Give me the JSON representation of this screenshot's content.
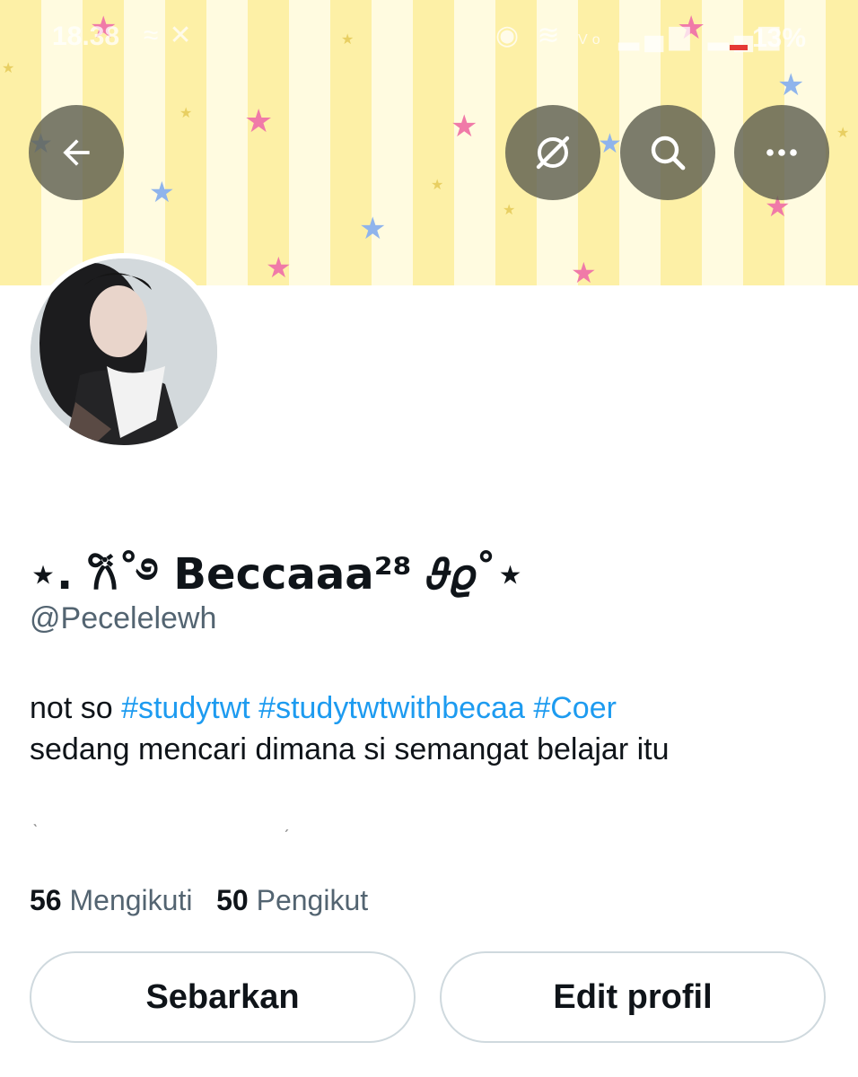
{
  "status_bar": {
    "time": "18.38",
    "battery": "13%",
    "icons_left": [
      "vpn-icon",
      "x-app-icon"
    ],
    "icons_right": [
      "location-icon",
      "wifi-icon",
      "volte-lte2-icon",
      "signal-icon",
      "signal-icon-2",
      "battery-icon"
    ]
  },
  "header": {
    "back_icon": "arrow-left-icon",
    "actions": [
      "hidden-icon",
      "search-icon",
      "more-icon"
    ]
  },
  "profile": {
    "display_name": "⋆. 𐙚˚࿔ Beccaaa²⁸ 𝜗𝜚˚⋆",
    "handle": "@Pecelelewh",
    "bio_line1_prefix": "not so ",
    "bio_tags": [
      "#studytwt",
      "#studytwtwithbecaa",
      "#Coer"
    ],
    "bio_line2": "sedang mencari dimana si semangat belajar itu"
  },
  "stats": {
    "following_count": "56",
    "following_label": "Mengikuti",
    "followers_count": "50",
    "followers_label": "Pengikut"
  },
  "buttons": {
    "share_label": "Sebarkan",
    "edit_label": "Edit profil"
  },
  "colors": {
    "banner_stripe_a": "#fdf0a6",
    "banner_stripe_b": "#fffbe0",
    "star_pink": "#f07aa8",
    "star_blue": "#8fb4ec",
    "link": "#1d9bf0",
    "muted": "#536471",
    "text": "#0f1419"
  }
}
